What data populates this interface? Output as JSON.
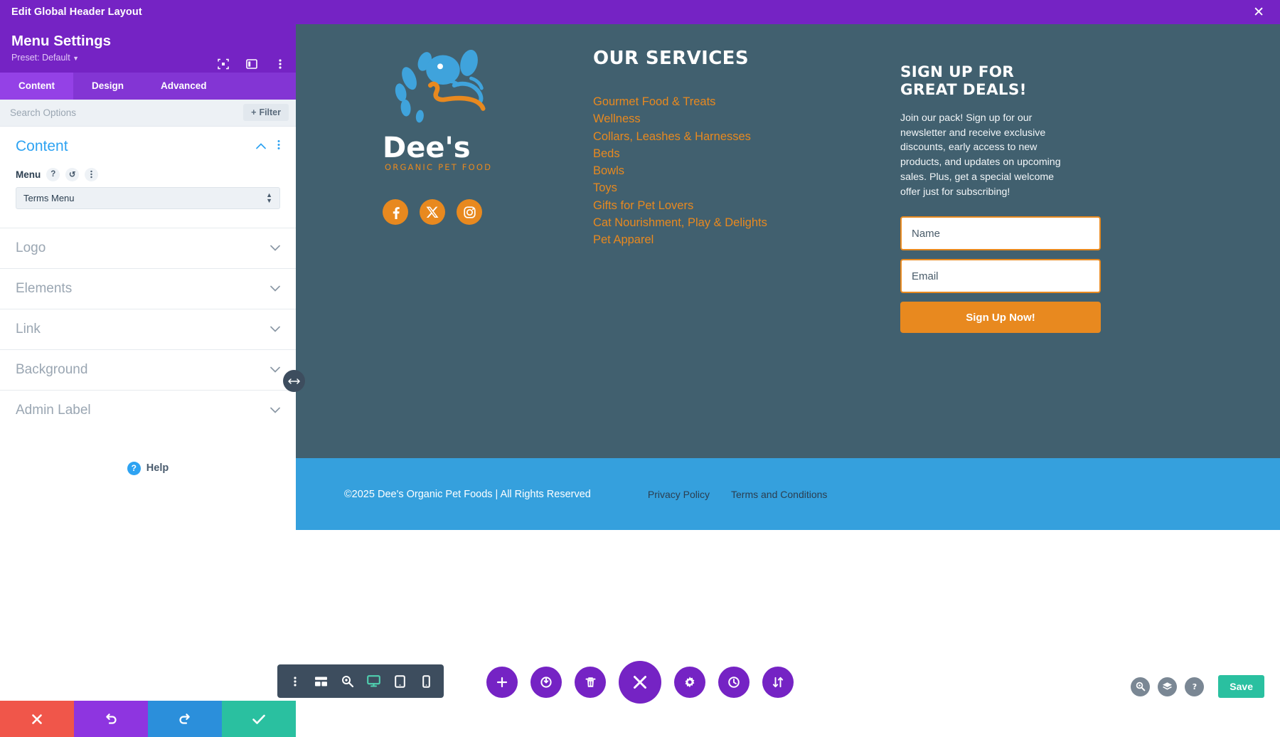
{
  "panel": {
    "window_title": "Edit Global Header Layout",
    "close_icon": "close-icon",
    "module_title": "Menu Settings",
    "preset_label": "Preset: Default",
    "head_icons": [
      "focus-icon",
      "panel-layout-icon",
      "more-options-icon"
    ],
    "tabs": [
      {
        "label": "Content",
        "active": true
      },
      {
        "label": "Design",
        "active": false
      },
      {
        "label": "Advanced",
        "active": false
      }
    ],
    "search": {
      "placeholder": "Search Options",
      "value": ""
    },
    "filter_label": "Filter",
    "content_section": {
      "title": "Content",
      "collapse_icon": "chevron-up-icon",
      "more_icon": "more-options-icon",
      "field": {
        "label": "Menu",
        "help_icon": "question-icon",
        "reset_icon": "reset-icon",
        "more_icon": "more-options-icon",
        "selected_value": "Terms Menu"
      }
    },
    "accordions": [
      {
        "label": "Logo"
      },
      {
        "label": "Elements"
      },
      {
        "label": "Link"
      },
      {
        "label": "Background"
      },
      {
        "label": "Admin Label"
      }
    ],
    "help_label": "Help",
    "actions": [
      {
        "name": "cancel",
        "icon": "close-icon",
        "color": "#F0564A"
      },
      {
        "name": "undo",
        "icon": "undo-icon",
        "color": "#8E35E0"
      },
      {
        "name": "redo",
        "icon": "redo-icon",
        "color": "#2B8FDB"
      },
      {
        "name": "save",
        "icon": "check-icon",
        "color": "#2AC0A0"
      }
    ],
    "drag_handle_icon": "resize-horizontal-icon"
  },
  "preview": {
    "background_color": "#41606F",
    "accent_orange": "#E8891F",
    "footer_blue": "#35A0DD",
    "logo": {
      "brand": "Dee's",
      "tagline": "ORGANIC PET FOOD",
      "mark": "dog-face-logo-icon"
    },
    "social": [
      {
        "name": "facebook-icon",
        "label": "Facebook"
      },
      {
        "name": "x-twitter-icon",
        "label": "X"
      },
      {
        "name": "instagram-icon",
        "label": "Instagram"
      }
    ],
    "services": {
      "heading": "OUR SERVICES",
      "items": [
        "Gourmet Food & Treats",
        "Wellness",
        "Collars, Leashes & Harnesses",
        "Beds",
        "Bowls",
        "Toys",
        "Gifts for Pet Lovers",
        "Cat Nourishment, Play & Delights",
        "Pet Apparel"
      ]
    },
    "signup": {
      "heading": "SIGN UP FOR GREAT DEALS!",
      "body": "Join our pack! Sign up for our newsletter and receive exclusive discounts, early access to new products, and updates on upcoming sales. Plus, get a special welcome offer just for subscribing!",
      "name_placeholder": "Name",
      "name_value": "",
      "email_placeholder": "Email",
      "email_value": "",
      "button_label": "Sign Up Now!"
    },
    "footer_bar": {
      "copyright": "©2025 Dee's Organic Pet Foods | All Rights Reserved",
      "links": [
        "Privacy Policy",
        "Terms and Conditions"
      ]
    }
  },
  "toolbars": {
    "device_bar": [
      {
        "name": "more-options-icon",
        "active": false
      },
      {
        "name": "wireframe-icon",
        "active": false
      },
      {
        "name": "zoom-out-icon",
        "active": false
      },
      {
        "name": "desktop-icon",
        "active": true
      },
      {
        "name": "tablet-icon",
        "active": false
      },
      {
        "name": "phone-icon",
        "active": false
      }
    ],
    "circle_bar": [
      {
        "name": "add-icon",
        "big": false
      },
      {
        "name": "power-icon",
        "big": false
      },
      {
        "name": "trash-icon",
        "big": false
      },
      {
        "name": "close-icon",
        "big": true
      },
      {
        "name": "settings-gear-icon",
        "big": false
      },
      {
        "name": "history-clock-icon",
        "big": false
      },
      {
        "name": "sort-arrows-icon",
        "big": false
      }
    ],
    "right_bar": [
      {
        "name": "search-icon"
      },
      {
        "name": "layers-icon"
      },
      {
        "name": "help-question-icon"
      }
    ],
    "save_label": "Save"
  }
}
